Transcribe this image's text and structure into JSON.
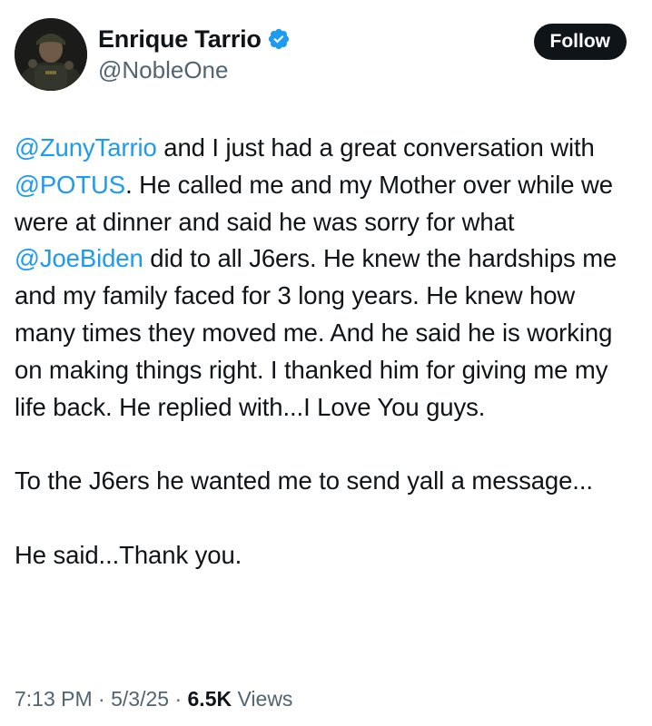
{
  "author": {
    "display_name": "Enrique Tarrio",
    "handle": "@NobleOne",
    "verified": true,
    "verified_color": "#1d9bf0"
  },
  "header": {
    "follow_label": "Follow"
  },
  "tweet": {
    "para1": {
      "m1": "@ZunyTarrio",
      "t1": " and I just had a great conversation with ",
      "m2": "@POTUS",
      "t2": ". He called me and my Mother over while we were at dinner and said he was sorry for what ",
      "m3": "@JoeBiden",
      "t3": " did to all J6ers. He knew the hardships me and my family faced for 3 long years. He knew how many times they moved me. And he said he is working on making things right. I thanked him for giving me my life back. He replied with...I Love You guys."
    },
    "para2": "To the J6ers he wanted me to send yall a message...",
    "para3": "He said...Thank you."
  },
  "meta": {
    "time": "7:13 PM",
    "separator": " · ",
    "date": "5/3/25",
    "views_count": "6.5K",
    "views_label": " Views"
  },
  "colors": {
    "link": "#1d9bf0",
    "text": "#0f1419",
    "muted": "#536471"
  }
}
